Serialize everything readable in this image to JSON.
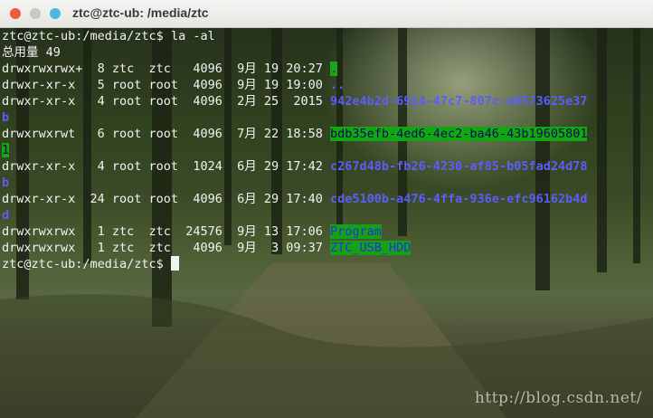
{
  "window": {
    "title": "ztc@ztc-ub: /media/ztc"
  },
  "prompt": "ztc@ztc-ub:/media/ztc$",
  "command": "la -al",
  "total": "总用量 49",
  "entries": [
    {
      "meta": "drwxrwxrwx+  8 ztc  ztc   4096  9月 19 20:27 ",
      "name": "."
    },
    {
      "meta": "drwxr-xr-x   5 root root  4096  9月 19 19:00 ",
      "name": ".."
    },
    {
      "meta": "drwxr-xr-x   4 root root  4096  2月 25  2015 ",
      "name": "942e4b2d-6914-47c7-807c-e0573625e37",
      "wrap": "b"
    },
    {
      "meta": "drwxrwxrwt   6 root root  4096  7月 22 18:58 ",
      "name": "bdb35efb-4ed6-4ec2-ba46-43b19605801",
      "wrap": "1"
    },
    {
      "meta": "drwxr-xr-x   4 root root  1024  6月 29 17:42 ",
      "name": "c267d48b-fb26-4230-af85-b05fad24d78",
      "wrap": "b"
    },
    {
      "meta": "drwxr-xr-x  24 root root  4096  6月 29 17:40 ",
      "name": "cde5100b-a476-4ffa-936e-efc96162b4d",
      "wrap": "d"
    },
    {
      "meta": "drwxrwxrwx   1 ztc  ztc  24576  9月 13 17:06 ",
      "name": "Program"
    },
    {
      "meta": "drwxrwxrwx   1 ztc  ztc   4096  9月  3 09:37 ",
      "name": "ZTC_USB_HDD"
    }
  ],
  "watermark": "http://blog.csdn.net/",
  "colors": {
    "dir_blue": "#5c5cff",
    "highlight_green": "#11a711",
    "text": "#f2f2f2"
  }
}
